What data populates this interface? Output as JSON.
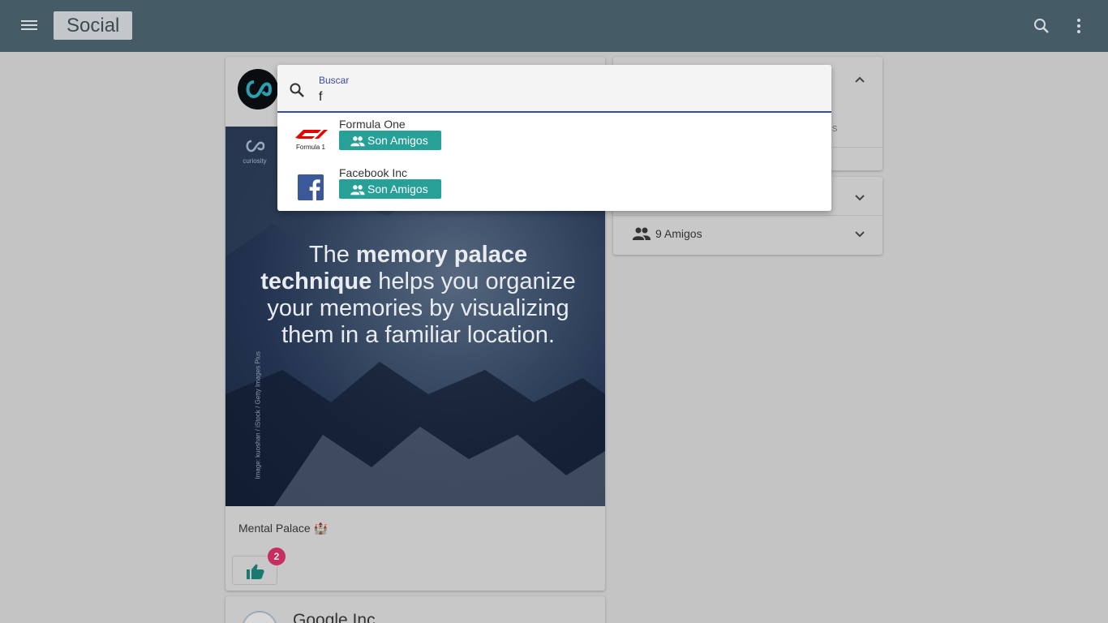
{
  "appbar": {
    "title": "Social",
    "icons": [
      "menu-icon",
      "search-icon",
      "more-vert-icon"
    ]
  },
  "post": {
    "image_text": {
      "headline_parts": [
        {
          "text": "The ",
          "bold": false
        },
        {
          "text": "memory palace technique",
          "bold": true
        },
        {
          "text": " helps you organize your memories by visualizing them in a familiar location.",
          "bold": false
        }
      ],
      "headline_prefix": "The ",
      "headline_bold": "memory palace technique",
      "headline_suffix": " helps you organize your memories by visualizing them in a familiar location.",
      "brand": "curiosity",
      "credit": "Image: kuoshan / iStock / Getty Images Plus"
    },
    "caption": "Mental Palace 🏰",
    "likes_count": "2"
  },
  "post2": {
    "author": "Google Inc"
  },
  "sidebar": {
    "card1_snippet": "s",
    "friends_label": "9 Amigos"
  },
  "search": {
    "label": "Buscar",
    "value": "f",
    "results": [
      {
        "name": "Formula One",
        "button": "Son Amigos",
        "logo": "formula1-logo"
      },
      {
        "name": "Facebook Inc",
        "button": "Son Amigos",
        "logo": "facebook-logo"
      }
    ]
  },
  "colors": {
    "appbar": "#455b66",
    "accent": "#27a098",
    "focus": "#3c4aa7",
    "badge": "#c52e60"
  }
}
